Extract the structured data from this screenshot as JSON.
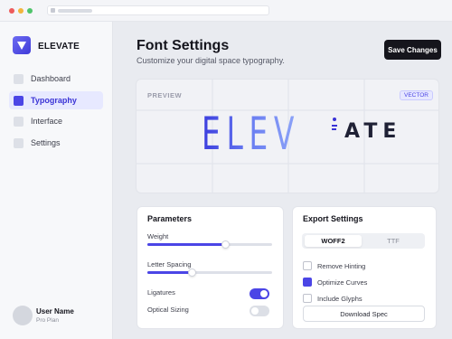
{
  "app": {
    "brand": "ELEVATE"
  },
  "sidebar": {
    "items": [
      {
        "label": "Dashboard",
        "active": false
      },
      {
        "label": "Typography",
        "active": true
      },
      {
        "label": "Interface",
        "active": false
      },
      {
        "label": "Settings",
        "active": false
      }
    ],
    "user": {
      "name": "User Name",
      "plan": "Pro Plan"
    }
  },
  "header": {
    "title": "Font Settings",
    "subtitle": "Customize your digital space typography.",
    "save_label": "Save Changes"
  },
  "preview": {
    "label": "PREVIEW",
    "badge": "VECTOR",
    "sample_gradient": "ELEV",
    "sample_dark": "ATE"
  },
  "parameters": {
    "title": "Parameters",
    "weight": {
      "label": "Weight",
      "value": 0.63
    },
    "letter_spacing": {
      "label": "Letter Spacing",
      "value": 0.36
    },
    "ligatures": {
      "label": "Ligatures",
      "on": true
    },
    "optical_sizing": {
      "label": "Optical Sizing",
      "on": false
    }
  },
  "export": {
    "title": "Export Settings",
    "formats": [
      "WOFF2",
      "TTF"
    ],
    "selected_format": "WOFF2",
    "options": [
      {
        "label": "Remove Hinting",
        "checked": false
      },
      {
        "label": "Optimize Curves",
        "checked": true
      },
      {
        "label": "Include Glyphs",
        "checked": false
      }
    ],
    "download_label": "Download Spec"
  },
  "colors": {
    "accent": "#4b45e6",
    "primary_button": "#15151c",
    "active_nav_bg": "#e7e9ff"
  },
  "icons": [
    "elevate-logo-icon",
    "nav-square-icon",
    "checkbox-icon"
  ]
}
